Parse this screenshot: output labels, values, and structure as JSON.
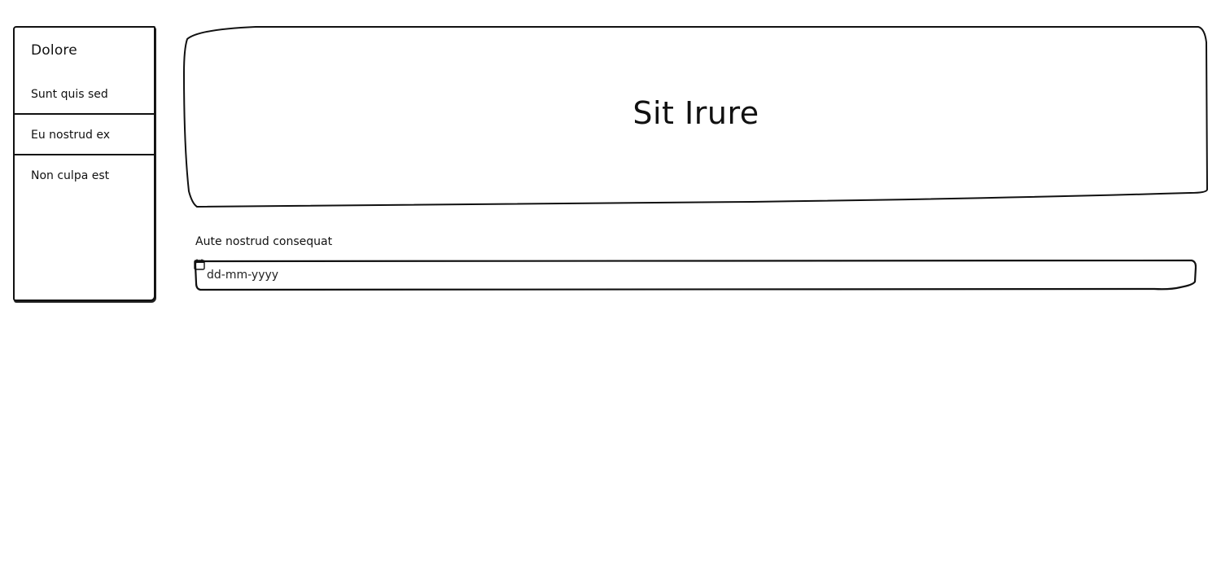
{
  "sidebar": {
    "title": "Dolore",
    "items": [
      {
        "label": "Sunt quis sed"
      },
      {
        "label": "Eu nostrud ex"
      },
      {
        "label": "Non culpa est"
      }
    ]
  },
  "hero": {
    "title": "Sit Irure"
  },
  "form": {
    "date_label": "Aute nostrud consequat",
    "date_placeholder": "dd-mm-yyyy"
  },
  "icons": {
    "calendar": "calendar-icon"
  },
  "colors": {
    "stroke": "#111111",
    "background": "#ffffff"
  }
}
